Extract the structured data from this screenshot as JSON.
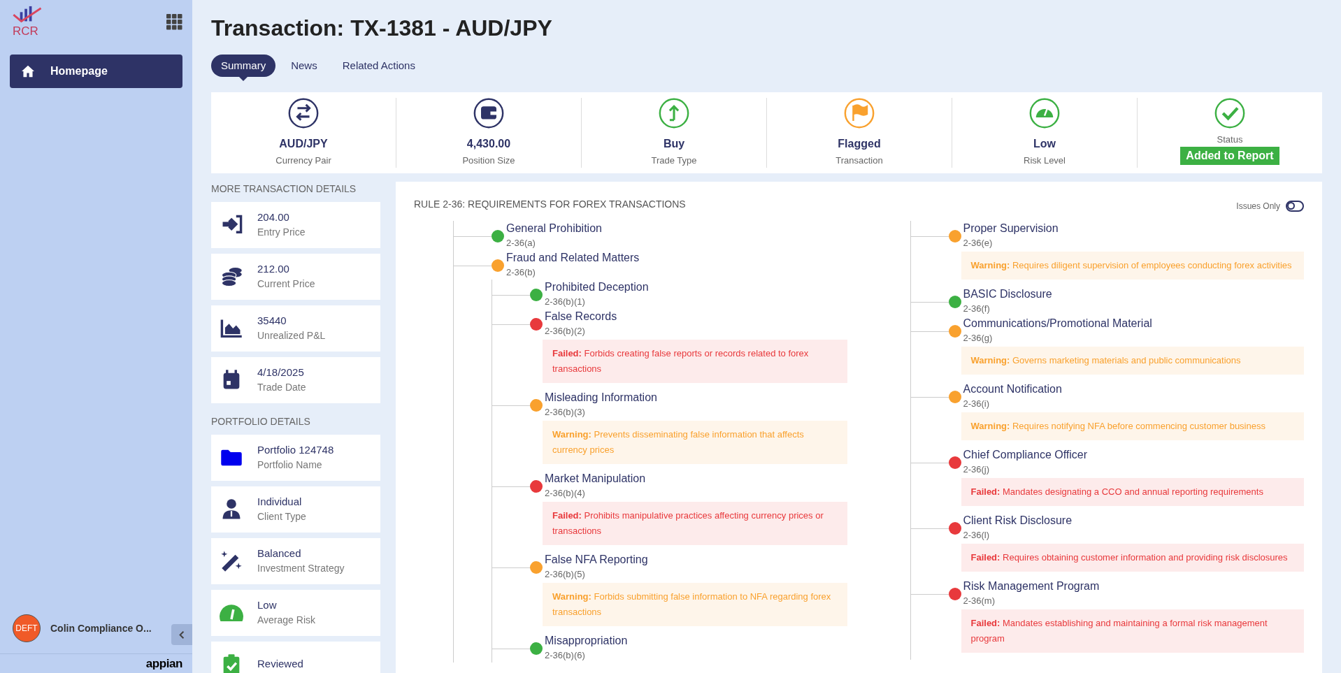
{
  "sidebar": {
    "logo_text": "RCR",
    "nav": [
      {
        "label": "Homepage",
        "selected": true
      }
    ],
    "user": {
      "avatar_text": "DEFT",
      "name": "Colin Compliance O..."
    },
    "brand": "appian"
  },
  "title": "Transaction: TX-1381 - AUD/JPY",
  "tabs": [
    {
      "label": "Summary",
      "selected": true
    },
    {
      "label": "News",
      "selected": false
    },
    {
      "label": "Related Actions",
      "selected": false
    }
  ],
  "kpis": [
    {
      "value": "AUD/JPY",
      "label": "Currency Pair",
      "color": "#2e3366"
    },
    {
      "value": "4,430.00",
      "label": "Position Size",
      "color": "#2e3366"
    },
    {
      "value": "Buy",
      "label": "Trade Type",
      "color": "#3cb043"
    },
    {
      "value": "Flagged",
      "label": "Transaction",
      "color": "#f9a12e"
    },
    {
      "value": "Low",
      "label": "Risk Level",
      "color": "#3cb043"
    },
    {
      "label": "Status",
      "badge": "Added to Report",
      "color": "#3cb043"
    }
  ],
  "transaction_details": {
    "heading": "MORE TRANSACTION DETAILS",
    "items": [
      {
        "value": "204.00",
        "label": "Entry Price",
        "color": "#2e3366"
      },
      {
        "value": "212.00",
        "label": "Current Price",
        "color": "#2e3366"
      },
      {
        "value": "35440",
        "label": "Unrealized P&L",
        "color": "#2e3366"
      },
      {
        "value": "4/18/2025",
        "label": "Trade Date",
        "color": "#2e3366"
      }
    ]
  },
  "portfolio_details": {
    "heading": "PORTFOLIO DETAILS",
    "items": [
      {
        "value": "Portfolio 124748",
        "label": "Portfolio Name",
        "color": "#0000ee"
      },
      {
        "value": "Individual",
        "label": "Client Type",
        "color": "#2e3366"
      },
      {
        "value": "Balanced",
        "label": "Investment Strategy",
        "color": "#2e3366"
      },
      {
        "value": "Low",
        "label": "Average Risk",
        "color": "#3cb043"
      },
      {
        "value": "Reviewed",
        "color": "#3cb043"
      }
    ]
  },
  "rule": {
    "title": "RULE 2-36: REQUIREMENTS FOR FOREX TRANSACTIONS",
    "issues_only": {
      "label": "Issues Only",
      "on": false
    },
    "columns": [
      [
        {
          "title": "General Prohibition",
          "code": "2-36(a)",
          "color": "#3cb043"
        },
        {
          "title": "Fraud and Related Matters",
          "code": "2-36(b)",
          "color": "#f9a12e",
          "children": [
            {
              "title": "Prohibited Deception",
              "code": "2-36(b)(1)",
              "color": "#3cb043"
            },
            {
              "title": "False Records",
              "code": "2-36(b)(2)",
              "color": "#e8393c",
              "note": {
                "label": "Failed:",
                "text": "Forbids creating false reports or records related to forex transactions"
              }
            },
            {
              "title": "Misleading Information",
              "code": "2-36(b)(3)",
              "color": "#f9a12e",
              "note": {
                "label": "Warning:",
                "text": "Prevents disseminating false information that affects currency prices"
              }
            },
            {
              "title": "Market Manipulation",
              "code": "2-36(b)(4)",
              "color": "#e8393c",
              "note": {
                "label": "Failed:",
                "text": "Prohibits manipulative practices affecting currency prices or transactions"
              }
            },
            {
              "title": "False NFA Reporting",
              "code": "2-36(b)(5)",
              "color": "#f9a12e",
              "note": {
                "label": "Warning:",
                "text": "Forbids submitting false information to NFA regarding forex transactions"
              }
            },
            {
              "title": "Misappropriation",
              "code": "2-36(b)(6)",
              "color": "#3cb043"
            }
          ]
        }
      ],
      [
        {
          "title": "Proper Supervision",
          "code": "2-36(e)",
          "color": "#f9a12e",
          "note": {
            "label": "Warning:",
            "text": "Requires diligent supervision of employees conducting forex activities"
          }
        },
        {
          "title": "BASIC Disclosure",
          "code": "2-36(f)",
          "color": "#3cb043"
        },
        {
          "title": "Communications/Promotional Material",
          "code": "2-36(g)",
          "color": "#f9a12e",
          "note": {
            "label": "Warning:",
            "text": "Governs marketing materials and public communications"
          }
        },
        {
          "title": "Account Notification",
          "code": "2-36(i)",
          "color": "#f9a12e",
          "note": {
            "label": "Warning:",
            "text": "Requires notifying NFA before commencing customer business"
          }
        },
        {
          "title": "Chief Compliance Officer",
          "code": "2-36(j)",
          "color": "#e8393c",
          "note": {
            "label": "Failed:",
            "text": "Mandates designating a CCO and annual reporting requirements"
          }
        },
        {
          "title": "Client Risk Disclosure",
          "code": "2-36(l)",
          "color": "#e8393c",
          "note": {
            "label": "Failed:",
            "text": "Requires obtaining customer information and providing risk disclosures"
          }
        },
        {
          "title": "Risk Management Program",
          "code": "2-36(m)",
          "color": "#e8393c",
          "note": {
            "label": "Failed:",
            "text": "Mandates establishing and maintaining a formal risk management program"
          }
        }
      ]
    ]
  }
}
